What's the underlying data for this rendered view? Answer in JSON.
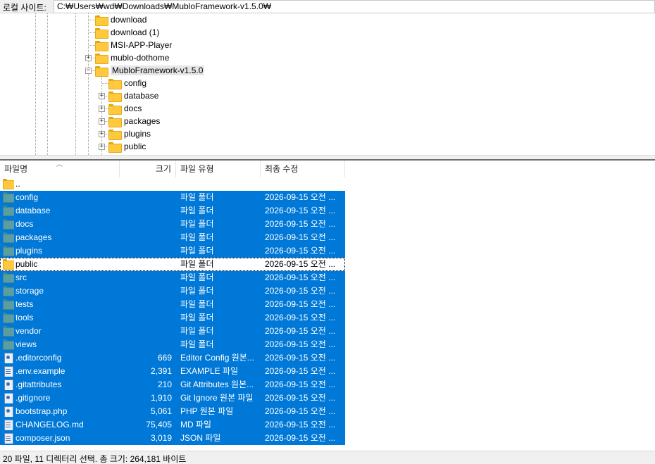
{
  "path_bar": {
    "label": "로컬 사이트:",
    "value": "C:₩Users₩wd₩Downloads₩MubloFramework-v1.5.0₩"
  },
  "tree": {
    "items": [
      {
        "label": "download",
        "expandable": false
      },
      {
        "label": "download (1)",
        "expandable": false
      },
      {
        "label": "MSI-APP-Player",
        "expandable": false
      },
      {
        "label": "mublo-dothome",
        "expandable": true,
        "expanded": false
      },
      {
        "label": "MubloFramework-v1.5.0",
        "expandable": true,
        "expanded": true,
        "selected": true
      },
      {
        "label": "config",
        "expandable": false
      },
      {
        "label": "database",
        "expandable": true,
        "expanded": false
      },
      {
        "label": "docs",
        "expandable": true,
        "expanded": false
      },
      {
        "label": "packages",
        "expandable": true,
        "expanded": false
      },
      {
        "label": "plugins",
        "expandable": true,
        "expanded": false
      },
      {
        "label": "public",
        "expandable": true,
        "expanded": false
      }
    ]
  },
  "list": {
    "columns": {
      "name": "파일명",
      "size": "크기",
      "type": "파일 유형",
      "modified": "최종 수정"
    },
    "rows": [
      {
        "name": "..",
        "size": "",
        "type": "",
        "modified": "",
        "icon": "parent-folder",
        "state": "none"
      },
      {
        "name": "config",
        "size": "",
        "type": "파일 폴더",
        "modified": "2026-09-15 오전 ...",
        "icon": "folder",
        "state": "selected"
      },
      {
        "name": "database",
        "size": "",
        "type": "파일 폴더",
        "modified": "2026-09-15 오전 ...",
        "icon": "folder",
        "state": "selected"
      },
      {
        "name": "docs",
        "size": "",
        "type": "파일 폴더",
        "modified": "2026-09-15 오전 ...",
        "icon": "folder",
        "state": "selected"
      },
      {
        "name": "packages",
        "size": "",
        "type": "파일 폴더",
        "modified": "2026-09-15 오전 ...",
        "icon": "folder",
        "state": "selected"
      },
      {
        "name": "plugins",
        "size": "",
        "type": "파일 폴더",
        "modified": "2026-09-15 오전 ...",
        "icon": "folder",
        "state": "selected"
      },
      {
        "name": "public",
        "size": "",
        "type": "파일 폴더",
        "modified": "2026-09-15 오전 ...",
        "icon": "folder",
        "state": "focused"
      },
      {
        "name": "src",
        "size": "",
        "type": "파일 폴더",
        "modified": "2026-09-15 오전 ...",
        "icon": "folder",
        "state": "selected"
      },
      {
        "name": "storage",
        "size": "",
        "type": "파일 폴더",
        "modified": "2026-09-15 오전 ...",
        "icon": "folder",
        "state": "selected"
      },
      {
        "name": "tests",
        "size": "",
        "type": "파일 폴더",
        "modified": "2026-09-15 오전 ...",
        "icon": "folder",
        "state": "selected"
      },
      {
        "name": "tools",
        "size": "",
        "type": "파일 폴더",
        "modified": "2026-09-15 오전 ...",
        "icon": "folder",
        "state": "selected"
      },
      {
        "name": "vendor",
        "size": "",
        "type": "파일 폴더",
        "modified": "2026-09-15 오전 ...",
        "icon": "folder",
        "state": "selected"
      },
      {
        "name": "views",
        "size": "",
        "type": "파일 폴더",
        "modified": "2026-09-15 오전 ...",
        "icon": "folder",
        "state": "selected"
      },
      {
        "name": ".editorconfig",
        "size": "669",
        "type": "Editor Config 원본...",
        "modified": "2026-09-15 오전 ...",
        "icon": "config-file",
        "state": "selected"
      },
      {
        "name": ".env.example",
        "size": "2,391",
        "type": "EXAMPLE 파일",
        "modified": "2026-09-15 오전 ...",
        "icon": "text-file",
        "state": "selected"
      },
      {
        "name": ".gitattributes",
        "size": "210",
        "type": "Git Attributes 원본...",
        "modified": "2026-09-15 오전 ...",
        "icon": "config-file",
        "state": "selected"
      },
      {
        "name": ".gitignore",
        "size": "1,910",
        "type": "Git Ignore 원본 파일",
        "modified": "2026-09-15 오전 ...",
        "icon": "config-file",
        "state": "selected"
      },
      {
        "name": "bootstrap.php",
        "size": "5,061",
        "type": "PHP 원본 파일",
        "modified": "2026-09-15 오전 ...",
        "icon": "config-file",
        "state": "selected"
      },
      {
        "name": "CHANGELOG.md",
        "size": "75,405",
        "type": "MD 파일",
        "modified": "2026-09-15 오전 ...",
        "icon": "text-file",
        "state": "selected"
      },
      {
        "name": "composer.json",
        "size": "3,019",
        "type": "JSON 파일",
        "modified": "2026-09-15 오전 ...",
        "icon": "text-file",
        "state": "selected"
      }
    ]
  },
  "status_bar": {
    "text": "20 파일, 11 디렉터리 선택. 총 크기: 264,181 바이트"
  },
  "colors": {
    "selection": "#0078d7",
    "folder_yellow": "#ffc83d",
    "folder_teal": "#5b9da0"
  }
}
